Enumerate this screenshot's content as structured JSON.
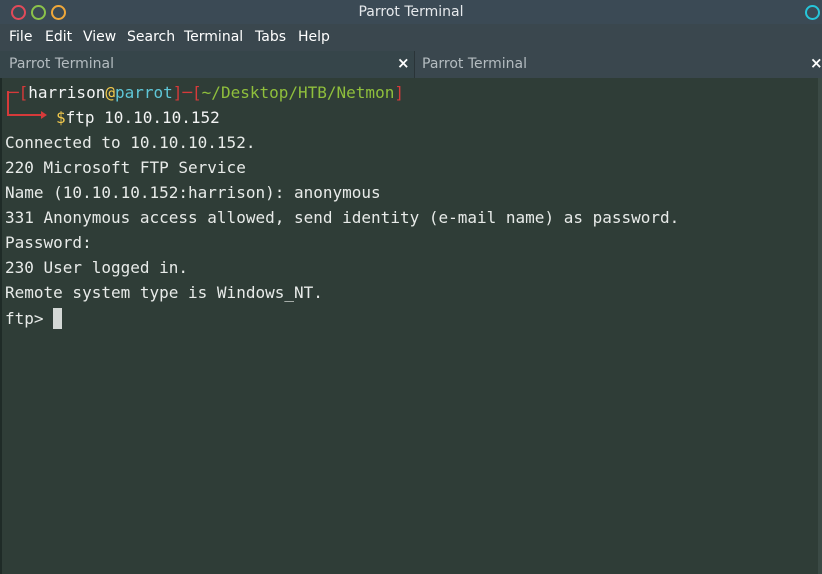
{
  "window": {
    "title": "Parrot Terminal"
  },
  "menu": {
    "items": [
      "File",
      "Edit",
      "View",
      "Search",
      "Terminal",
      "Tabs",
      "Help"
    ]
  },
  "tabs": [
    {
      "label": "Parrot Terminal",
      "close": "×",
      "active": true
    },
    {
      "label": "Parrot Terminal",
      "close": "×",
      "active": false
    }
  ],
  "prompt": {
    "dash_open": "─[",
    "user": "harrison",
    "at": "@",
    "host": "parrot",
    "sep": "]─[",
    "path": "~/Desktop/HTB/Netmon",
    "close": "]",
    "dollar": "$",
    "command": "ftp 10.10.10.152"
  },
  "output": [
    "Connected to 10.10.10.152.",
    "220 Microsoft FTP Service",
    "Name (10.10.10.152:harrison): anonymous",
    "331 Anonymous access allowed, send identity (e-mail name) as password.",
    "Password:",
    "230 User logged in.",
    "Remote system type is Windows_NT."
  ],
  "ftp_prompt": "ftp> ",
  "colors": {
    "prompt_red": "#d63a3a",
    "host_cyan": "#5fc7d8",
    "at_yellow": "#f2c94c",
    "path_green": "#8fbf3c",
    "terminal_bg": "#2f3d37"
  }
}
